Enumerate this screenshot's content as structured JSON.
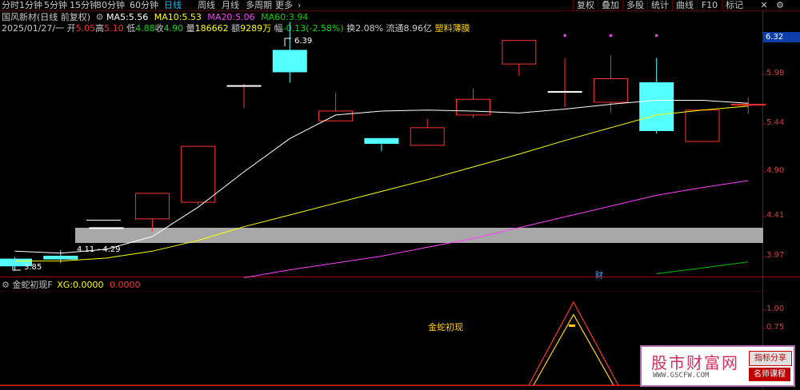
{
  "periods": [
    "分时",
    "1分钟",
    "5分钟",
    "15分钟",
    "30分钟",
    "60分钟",
    "日线",
    "周线",
    "月线",
    "多周期",
    "更多"
  ],
  "active_period": "日线",
  "more_caret": "›",
  "right_buttons": [
    "复权",
    "叠加",
    "多股",
    "统计",
    "曲线",
    "F10",
    "标记"
  ],
  "right_icons": [
    "✕",
    "⚙"
  ],
  "stock": {
    "name_line": "国风新材(日线 前复权)",
    "ma5_label": "MA5:",
    "ma5": "5.56",
    "ma10_label": "MA10:",
    "ma10": "5.53",
    "ma20_label": "MA20:",
    "ma20": "5.06",
    "ma60_label": "MA60:",
    "ma60": "3.94",
    "date": "2025/01/27/一",
    "open_label": "开",
    "open": "5.05",
    "high_label": "高",
    "high": "5.10",
    "low_label": "低",
    "low": "4.88",
    "close_label": "收",
    "close": "4.90",
    "vol_label": "量",
    "vol": "186662",
    "amt_label": "额",
    "amt": "9289万",
    "chg_label": "幅",
    "chg": "-0.13(-2.58%)",
    "turn_label": "换",
    "turn": "2.08%",
    "float_label": "流通",
    "float": "8.96亿",
    "sector": "塑料薄膜"
  },
  "price_axis": [
    "5.98",
    "5.44",
    "4.90",
    "4.41",
    "3.97"
  ],
  "current_price": "6.32",
  "annotations": {
    "high": "6.39",
    "low": "3.85",
    "range": "4.11 - 4.29",
    "cai": "财"
  },
  "indicator": {
    "name": "金蛇初现F",
    "xg_label": "XG:",
    "xg": "0.0000",
    "val2": "0.0000",
    "signal_text": "金蛇初现",
    "axis": [
      "1.00",
      "0.75"
    ]
  },
  "watermark": {
    "title": "股市财富网",
    "url": "WWW.GSCFW.COM",
    "tag1": "指标分享",
    "tag2": "名师课程"
  },
  "colors": {
    "up": "#ff3232",
    "down": "#54ffff",
    "ma5": "#ffffff",
    "ma10": "#ffff00",
    "ma20": "#ff40ff",
    "ma60": "#00c000",
    "accent": "#00c8ff"
  },
  "chart_data": {
    "type": "candlestick",
    "candles": [
      {
        "o": 3.97,
        "h": 3.99,
        "l": 3.85,
        "c": 3.9
      },
      {
        "o": 4.0,
        "h": 4.06,
        "l": 3.93,
        "c": 3.97
      },
      {
        "o": 4.29,
        "h": 4.29,
        "l": 4.29,
        "c": 4.29
      },
      {
        "o": 4.38,
        "h": 4.64,
        "l": 4.25,
        "c": 4.64
      },
      {
        "o": 4.55,
        "h": 5.12,
        "l": 4.52,
        "c": 5.12
      },
      {
        "o": 5.74,
        "h": 5.76,
        "l": 5.51,
        "c": 5.74
      },
      {
        "o": 6.1,
        "h": 6.39,
        "l": 5.77,
        "c": 5.88
      },
      {
        "o": 5.38,
        "h": 5.67,
        "l": 5.38,
        "c": 5.48
      },
      {
        "o": 5.2,
        "h": 5.2,
        "l": 5.07,
        "c": 5.15
      },
      {
        "o": 5.13,
        "h": 5.4,
        "l": 5.13,
        "c": 5.31
      },
      {
        "o": 5.44,
        "h": 5.71,
        "l": 5.41,
        "c": 5.6
      },
      {
        "o": 5.96,
        "h": 6.12,
        "l": 5.84,
        "c": 6.2
      },
      {
        "o": 5.68,
        "h": 6.02,
        "l": 5.52,
        "c": 5.68
      },
      {
        "o": 5.57,
        "h": 6.05,
        "l": 5.46,
        "c": 5.81
      },
      {
        "o": 5.77,
        "h": 6.02,
        "l": 5.25,
        "c": 5.28
      },
      {
        "o": 5.17,
        "h": 5.5,
        "l": 5.17,
        "c": 5.49
      },
      {
        "o": 5.54,
        "h": 5.62,
        "l": 5.45,
        "c": 5.55
      }
    ],
    "ma5": [
      4.05,
      4.03,
      4.07,
      4.2,
      4.5,
      4.86,
      5.2,
      5.44,
      5.48,
      5.49,
      5.48,
      5.46,
      5.5,
      5.55,
      5.59,
      5.59,
      5.56
    ],
    "ma10": [
      3.95,
      3.95,
      3.98,
      4.05,
      4.16,
      4.3,
      4.42,
      4.54,
      4.66,
      4.78,
      4.91,
      5.04,
      5.18,
      5.31,
      5.44,
      5.49,
      5.53
    ],
    "ma20": [
      null,
      null,
      null,
      null,
      null,
      3.78,
      3.86,
      3.93,
      4.0,
      4.09,
      4.18,
      4.29,
      4.4,
      4.51,
      4.62,
      4.7,
      4.77
    ],
    "ma60": [
      null,
      null,
      null,
      null,
      null,
      null,
      null,
      null,
      null,
      null,
      null,
      null,
      null,
      null,
      3.82,
      3.88,
      3.94
    ],
    "ylim": [
      3.8,
      6.45
    ],
    "indicator_values": [
      0,
      0,
      0,
      0,
      0,
      0,
      0,
      0,
      0,
      0,
      0,
      0,
      0,
      1.12,
      0,
      0,
      0
    ],
    "indicator_ylim": [
      0,
      1.25
    ]
  }
}
